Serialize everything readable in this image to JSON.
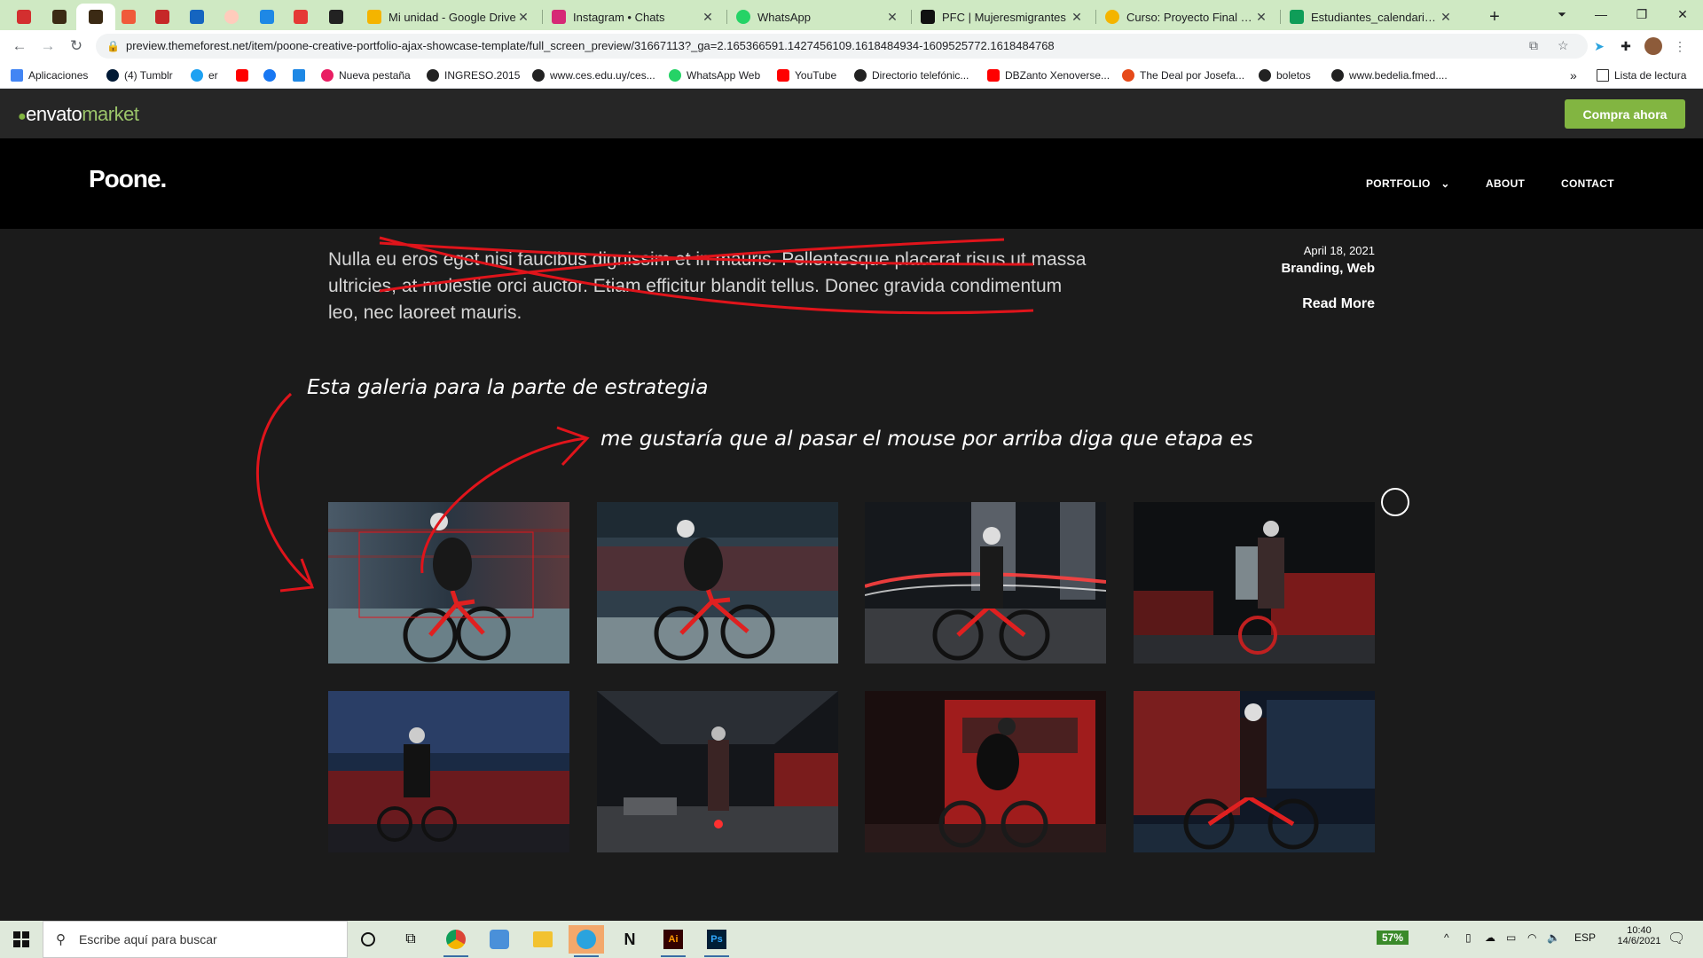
{
  "browser": {
    "tabs": [
      {
        "title": "Mi unidad - Google Drive",
        "color": "#f4b400"
      },
      {
        "title": "Instagram • Chats",
        "color": "#d62976"
      },
      {
        "title": "WhatsApp",
        "color": "#25d366"
      },
      {
        "title": "PFC | Mujeresmigrantes",
        "color": "#111111"
      },
      {
        "title": "Curso: Proyecto Final de Ca",
        "color": "#f4b400"
      },
      {
        "title": "Estudiantes_calendario form",
        "color": "#0f9d58"
      }
    ],
    "url": "preview.themeforest.net/item/poone-creative-portfolio-ajax-showcase-template/full_screen_preview/31667113?_ga=2.165366591.1427456109.1618484934-1609525772.1618484768",
    "new_tab": "+",
    "bookmarks": [
      {
        "label": "Aplicaciones",
        "color": "#4285f4"
      },
      {
        "label": "(4) Tumblr",
        "color": "#001935"
      },
      {
        "label": "er",
        "color": "#1da1f2"
      },
      {
        "label": "",
        "color": "#ff0000"
      },
      {
        "label": "",
        "color": "#1877f2"
      },
      {
        "label": "",
        "color": "#1e88e5"
      },
      {
        "label": "Nueva pestaña",
        "color": "#e91e63"
      },
      {
        "label": "INGRESO.2015",
        "color": "#222222"
      },
      {
        "label": "www.ces.edu.uy/ces...",
        "color": "#222222"
      },
      {
        "label": "WhatsApp Web",
        "color": "#25d366"
      },
      {
        "label": "YouTube",
        "color": "#ff0000"
      },
      {
        "label": "Directorio telefónic...",
        "color": "#222222"
      },
      {
        "label": "DBZanto Xenoverse...",
        "color": "#ff0000"
      },
      {
        "label": "The Deal por Josefa...",
        "color": "#e64a19"
      },
      {
        "label": "boletos",
        "color": "#222222"
      },
      {
        "label": "www.bedelia.fmed....",
        "color": "#222222"
      }
    ],
    "more_bookmarks": "»",
    "reading_list": "Lista de lectura"
  },
  "envato": {
    "logo_main": "envato",
    "logo_market": "market",
    "buy_label": "Compra ahora",
    "accent": "#82b541"
  },
  "site": {
    "logo": "Poone.",
    "nav": [
      {
        "label": "PORTFOLIO"
      },
      {
        "label": "ABOUT"
      },
      {
        "label": "CONTACT"
      }
    ]
  },
  "post": {
    "body": "Nulla eu eros eget nisi faucibus dignissim et in mauris. Pellentesque placerat risus ut massa ultricies, at molestie orci auctor. Etiam efficitur blandit tellus. Donec gravida condimentum leo, nec laoreet mauris.",
    "date": "April 18, 2021",
    "categories": "Branding, Web",
    "read_more": "Read More"
  },
  "annotations": {
    "note1": "Esta galeria para la parte de estrategia",
    "note2": "me gustaría que al pasar el mouse por arriba diga que etapa es",
    "color": "#e0141b"
  },
  "gallery": [
    {
      "scene": "cyclist-blur-red-bike"
    },
    {
      "scene": "cyclist-riding-bridge"
    },
    {
      "scene": "cyclist-standing-light-trails"
    },
    {
      "scene": "cyclist-standing-corridor"
    },
    {
      "scene": "cyclist-riding-bridge-night"
    },
    {
      "scene": "cyclist-walking-tunnel"
    },
    {
      "scene": "cyclist-passing-firetruck"
    },
    {
      "scene": "cyclist-standing-fire-station"
    }
  ],
  "taskbar": {
    "search_placeholder": "Escribe aquí para buscar",
    "battery": "57%",
    "language": "ESP",
    "time": "10:40",
    "date": "14/6/2021"
  }
}
